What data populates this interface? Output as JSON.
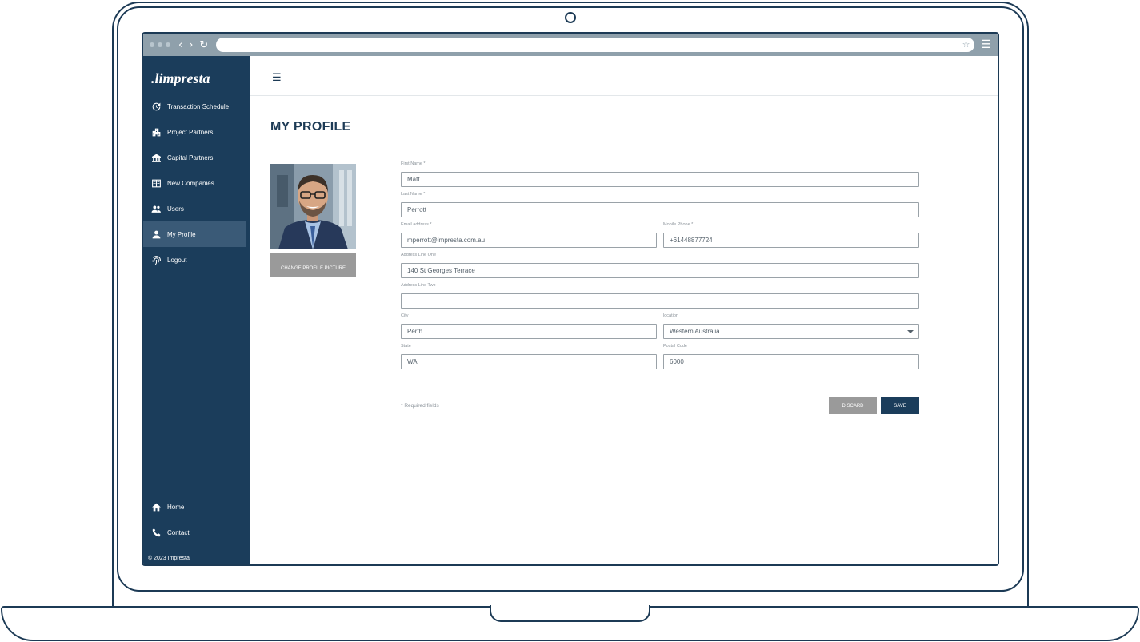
{
  "brand": {
    "logo_text": ".limpresta",
    "sidebar_color": "#1b3d5b",
    "accent": "#1b3d5b"
  },
  "sidebar": {
    "items": [
      {
        "label": "Transaction Schedule",
        "icon": "schedule-icon"
      },
      {
        "label": "Project Partners",
        "icon": "buildings-icon"
      },
      {
        "label": "Capital Partners",
        "icon": "bank-icon"
      },
      {
        "label": "New Companies",
        "icon": "office-building-icon"
      },
      {
        "label": "Users",
        "icon": "users-icon"
      },
      {
        "label": "My Profile",
        "icon": "person-icon",
        "active": true
      },
      {
        "label": "Logout",
        "icon": "fingerprint-icon"
      }
    ],
    "bottom_items": [
      {
        "label": "Home",
        "icon": "home-icon"
      },
      {
        "label": "Contact",
        "icon": "phone-icon"
      }
    ],
    "copyright": "© 2023 Impresta"
  },
  "page": {
    "title": "MY PROFILE",
    "change_picture_label": "CHANGE PROFILE PICTURE"
  },
  "form": {
    "first_name": {
      "label": "First Name *",
      "value": "Matt"
    },
    "last_name": {
      "label": "Last Name *",
      "value": "Perrott"
    },
    "email": {
      "label": "Email address *",
      "value": "mperrott@impresta.com.au"
    },
    "mobile": {
      "label": "Mobile Phone *",
      "value": "+61448877724"
    },
    "address1": {
      "label": "Address Line One",
      "value": "140 St Georges Terrace"
    },
    "address2": {
      "label": "Address Line Two",
      "value": ""
    },
    "city": {
      "label": "City",
      "value": "Perth"
    },
    "location": {
      "label": "location",
      "value": "Western Australia"
    },
    "state": {
      "label": "State",
      "value": "WA"
    },
    "postal": {
      "label": "Postal Code",
      "value": "6000"
    },
    "required_note": "* Required fields",
    "discard_label": "DISCARD",
    "save_label": "SAVE"
  }
}
